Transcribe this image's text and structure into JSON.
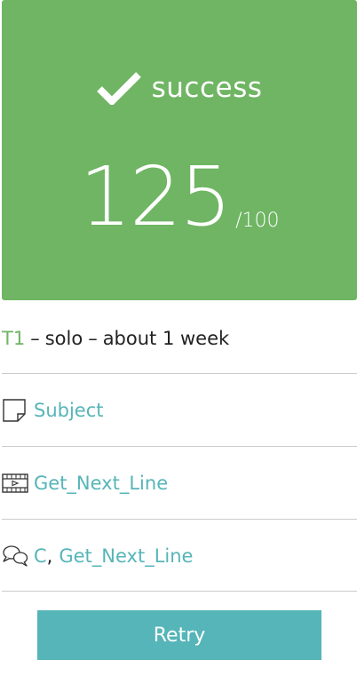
{
  "result": {
    "status": "success",
    "score": "125",
    "max": "/100"
  },
  "project": {
    "tier": "T1",
    "separator1": "–",
    "mode": "solo",
    "separator2": "–",
    "duration": "about 1 week"
  },
  "links": {
    "subject": {
      "icon": "page-icon",
      "label": "Subject"
    },
    "video": {
      "icon": "video-icon",
      "label": "Get_Next_Line"
    },
    "forum": {
      "icon": "chat-icon",
      "lang": "C",
      "comma": ",",
      "label": "Get_Next_Line"
    }
  },
  "retry": {
    "label": "Retry"
  },
  "colors": {
    "success": "#6fb563",
    "link": "#56b5b8",
    "divider": "#cccccc"
  }
}
